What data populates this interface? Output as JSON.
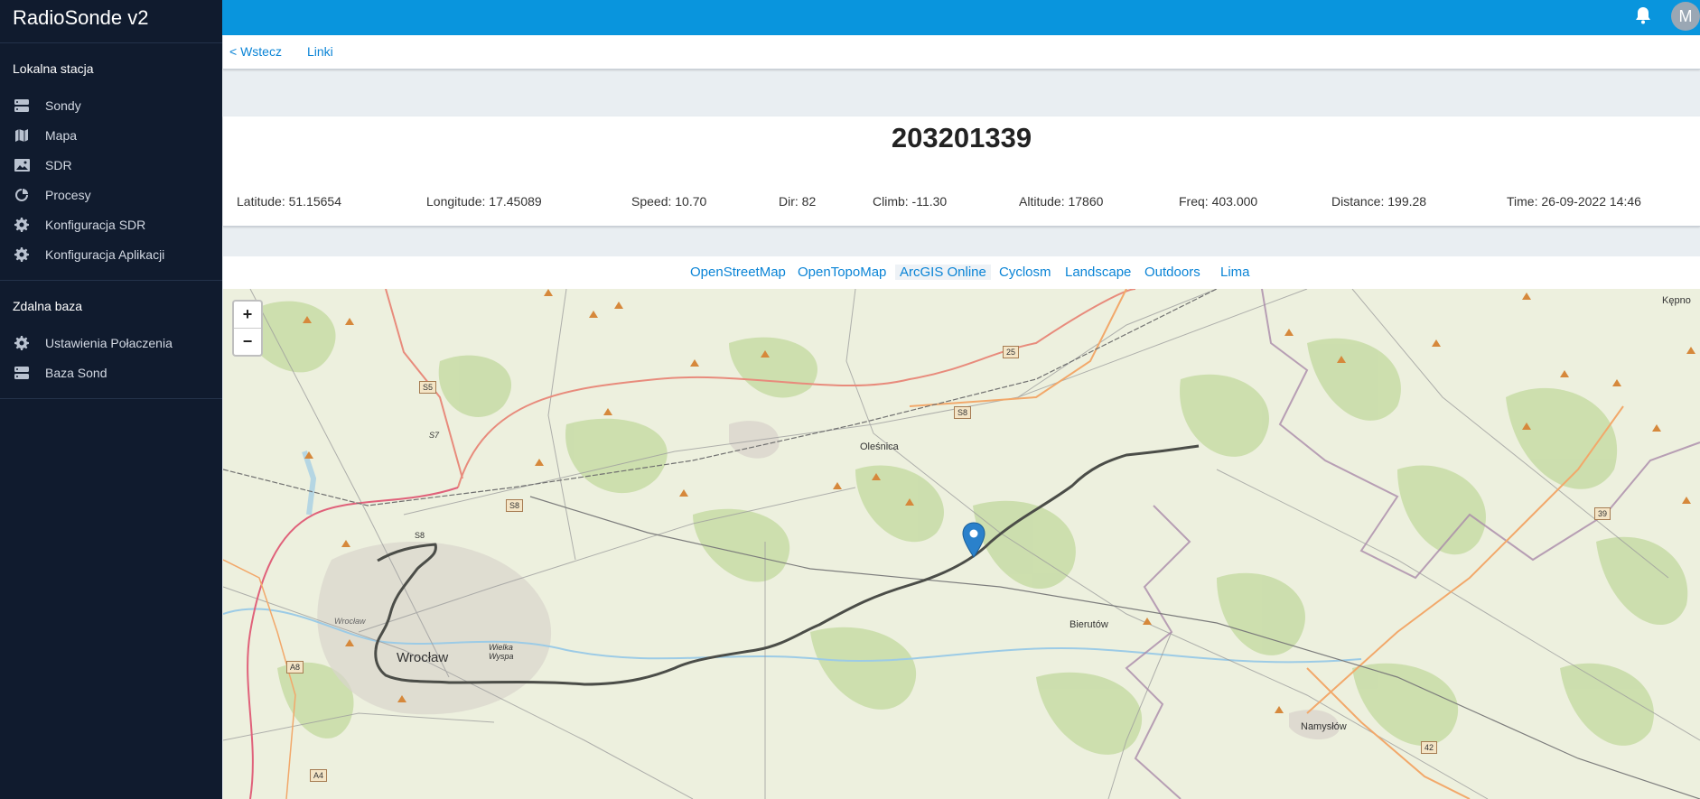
{
  "app": {
    "title": "RadioSonde v2"
  },
  "sidebar": {
    "local_section": "Lokalna stacja",
    "local_items": [
      {
        "label": "Sondy",
        "icon": "server-icon"
      },
      {
        "label": "Mapa",
        "icon": "map-icon"
      },
      {
        "label": "SDR",
        "icon": "image-icon"
      },
      {
        "label": "Procesy",
        "icon": "process-icon"
      },
      {
        "label": "Konfiguracja SDR",
        "icon": "gear-icon"
      },
      {
        "label": "Konfiguracja Aplikacji",
        "icon": "gear-icon"
      }
    ],
    "remote_section": "Zdalna baza",
    "remote_items": [
      {
        "label": "Ustawienia Połaczenia",
        "icon": "gear-icon"
      },
      {
        "label": "Baza Sond",
        "icon": "server-icon"
      }
    ]
  },
  "topbar": {
    "avatar_letter": "M",
    "accent": "#0995dd"
  },
  "subnav": {
    "back": "< Wstecz",
    "links": "Linki"
  },
  "sonde": {
    "id": "203201339",
    "stats": {
      "latitude": "Latitude: 51.15654",
      "longitude": "Longitude: 17.45089",
      "speed": "Speed: 10.70",
      "dir": "Dir: 82",
      "climb": "Climb: -11.30",
      "altitude": "Altitude: 17860",
      "freq": "Freq: 403.000",
      "distance": "Distance: 199.28",
      "time": "Time: 26-09-2022 14:46"
    }
  },
  "map": {
    "layers": [
      "OpenStreetMap",
      "OpenTopoMap",
      "ArcGIS Online",
      "Cyclosm",
      "Landscape",
      "Outdoors",
      "Lima"
    ],
    "active_layer": "ArcGIS Online",
    "zoom_in": "+",
    "zoom_out": "−",
    "places": {
      "olesnica": "Oleśnica",
      "wroclaw": "Wrocław",
      "wroclaw_small": "Wrocław",
      "wielka_wyspa": "Wielka Wyspa",
      "bierutow": "Bierutów",
      "namyslow": "Namysłów",
      "kepno": "Kępno"
    },
    "roads": [
      "25",
      "S8",
      "S5",
      "S7",
      "S8",
      "S8",
      "A8",
      "39",
      "42",
      "A4"
    ]
  }
}
